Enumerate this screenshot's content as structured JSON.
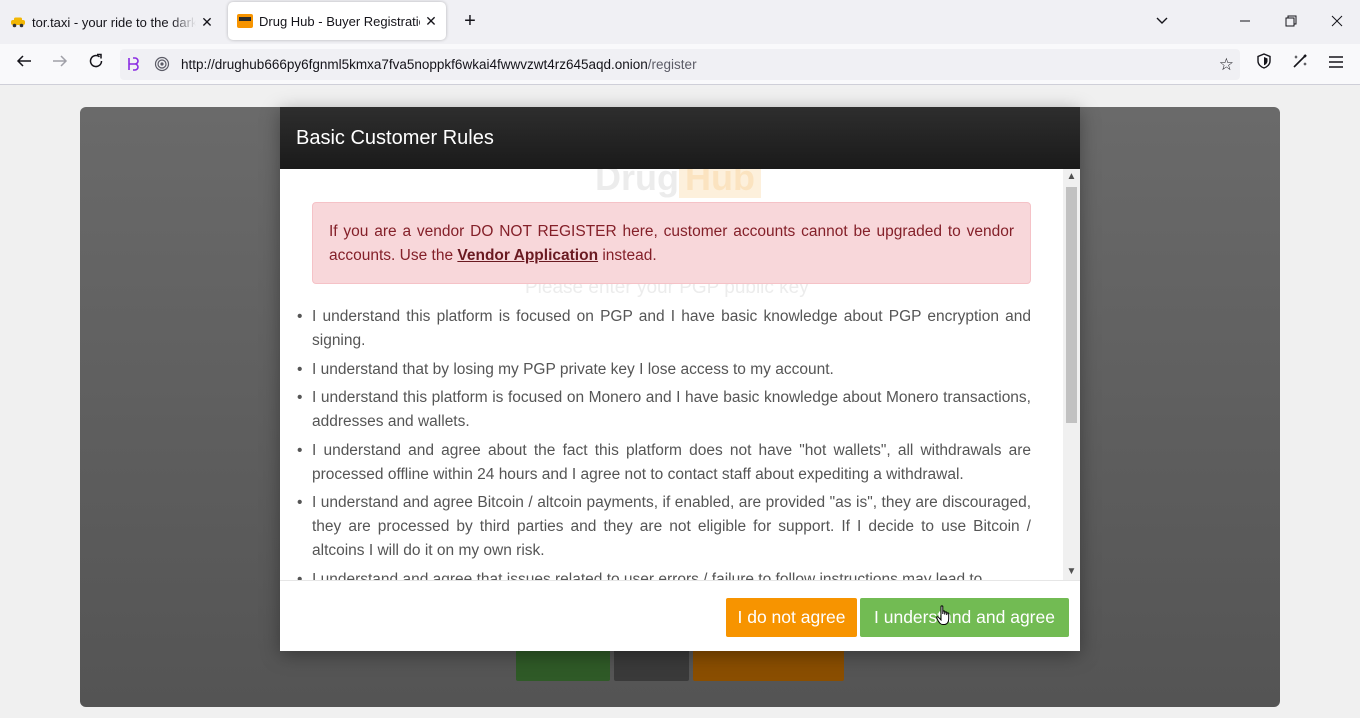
{
  "browser": {
    "tabs": [
      {
        "title": "tor.taxi - your ride to the darknet",
        "favicon": "taxi-icon",
        "active": false
      },
      {
        "title": "Drug Hub - Buyer Registration",
        "favicon": "drughub-icon",
        "active": true
      }
    ],
    "url": {
      "domain": "http://drughub666py6fgnml5kmxa7fva5noppkf6wkai4fwwvzwt4rz645aqd.onion",
      "path": "/register"
    }
  },
  "page": {
    "background_logo": {
      "part1": "Drug",
      "part2": "Hub"
    },
    "background_prompt": "Please enter your PGP public key"
  },
  "modal": {
    "title": "Basic Customer Rules",
    "alert": {
      "text_before": "If you are a vendor DO NOT REGISTER here, customer accounts cannot be upgraded to vendor accounts. Use the ",
      "link_text": "Vendor Application",
      "text_after": " instead."
    },
    "rules": [
      "I understand this platform is focused on PGP and I have basic knowledge about PGP encryption and signing.",
      "I understand that by losing my PGP private key I lose access to my account.",
      "I understand this platform is focused on Monero and I have basic knowledge about Monero transactions, addresses and wallets.",
      "I understand and agree about the fact this platform does not have \"hot wallets\", all withdrawals are processed offline within 24 hours and I agree not to contact staff about expediting a withdrawal.",
      "I understand and agree Bitcoin / altcoin payments, if enabled, are provided \"as is\", they are discouraged, they are processed by third parties and they are not eligible for support. If I decide to use Bitcoin / altcoins I will do it on my own risk.",
      "I understand and agree that issues related to user errors / failure to follow instructions may lead to"
    ],
    "buttons": {
      "disagree": "I do not agree",
      "agree": "I understand and agree"
    }
  },
  "colors": {
    "modal_header": "#1a1a1a",
    "alert_bg": "#f8d7da",
    "alert_text": "#842029",
    "disagree_button": "#f79400",
    "agree_button": "#72bb53"
  }
}
